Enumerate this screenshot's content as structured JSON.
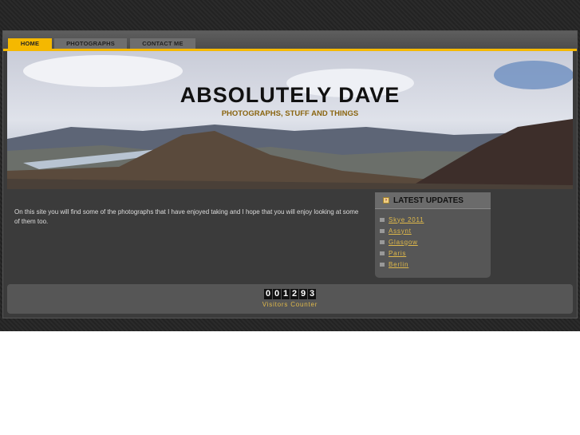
{
  "nav": {
    "tabs": [
      {
        "label": "HOME",
        "active": true
      },
      {
        "label": "PHOTOGRAPHS",
        "active": false
      },
      {
        "label": "CONTACT ME",
        "active": false
      }
    ]
  },
  "header": {
    "title": "ABSOLUTELY DAVE",
    "subtitle": "PHOTOGRAPHS, STUFF AND THINGS"
  },
  "main": {
    "intro": "On this site you will find some of the photographs that I have enjoyed taking and I hope that you will enjoy looking at some of them too."
  },
  "sidebar": {
    "heading": "LATEST UPDATES",
    "items": [
      "Skye 2011",
      "Assynt",
      "Glasgow",
      "Paris",
      "Berlin"
    ]
  },
  "footer": {
    "counter_digits": [
      "0",
      "0",
      "1",
      "2",
      "9",
      "3"
    ],
    "counter_label": "Visitors Counter"
  },
  "colors": {
    "accent": "#f5b800",
    "link": "#e0b94a"
  }
}
